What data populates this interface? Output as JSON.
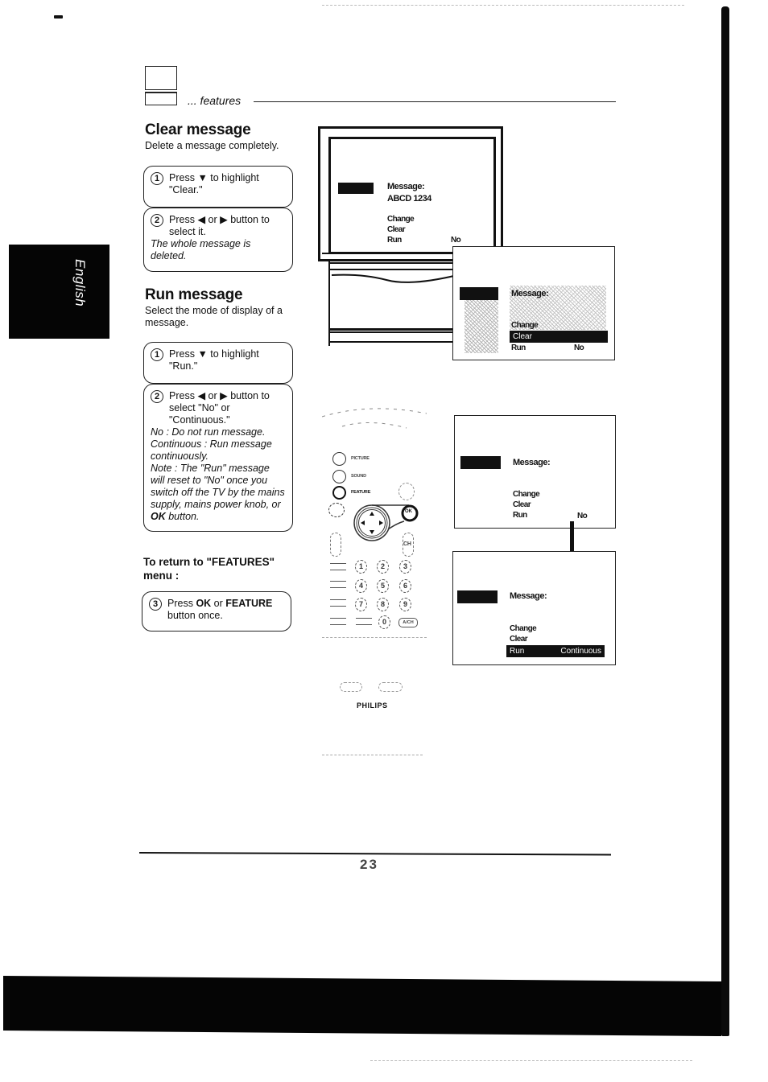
{
  "header": {
    "section_label": "... features",
    "icon": "tv-set-icon"
  },
  "side_tab": {
    "language": "English"
  },
  "clear_message": {
    "title": "Clear message",
    "description": "Delete a message completely.",
    "steps": [
      {
        "number": "1",
        "text_before": "Press ",
        "glyph": "▼",
        "text_after": " to highlight \"Clear.\""
      },
      {
        "number": "2",
        "text_before": "Press ",
        "glyph_left": "◀",
        "mid": " or ",
        "glyph_right": "▶",
        "text_after": " button to select it.",
        "note": "The whole message is deleted."
      }
    ]
  },
  "run_message": {
    "title": "Run message",
    "description": "Select the mode of display of a message.",
    "steps": [
      {
        "number": "1",
        "text_before": "Press ",
        "glyph": "▼",
        "text_after": " to highlight \"Run.\""
      },
      {
        "number": "2",
        "text_before": "Press ",
        "glyph_left": "◀",
        "mid": " or ",
        "glyph_right": "▶",
        "text_after": " button to select \"No\" or \"Continuous.\"",
        "notes": [
          "No : Do not run message.",
          "Continuous : Run message continuously.",
          "Note : The \"Run\" message will reset to \"No\" once you switch off the TV by the mains supply, mains power knob, or ",
          "OK",
          " button."
        ]
      }
    ]
  },
  "return": {
    "heading": "To return to \"FEATURES\" menu :",
    "step": {
      "number": "3",
      "pre": "Press ",
      "key1": "OK",
      "mid": " or ",
      "key2": "FEATURE",
      "post": " button once."
    }
  },
  "tv_screen": {
    "message_label": "Message:",
    "message_value": "ABCD 1234",
    "items": [
      "Change",
      "Clear",
      "Run"
    ],
    "run_value": "No"
  },
  "panel_clear": {
    "message_label": "Message:",
    "items": [
      "Change",
      "Clear",
      "Run"
    ],
    "highlighted": "Clear",
    "run_value": "No"
  },
  "panel_run_before": {
    "message_label": "Message:",
    "items": [
      "Change",
      "Clear",
      "Run"
    ],
    "run_value": "No"
  },
  "panel_run_after": {
    "message_label": "Message:",
    "items": [
      "Change",
      "Clear"
    ],
    "highlighted_label": "Run",
    "highlighted_value": "Continuous"
  },
  "remote": {
    "buttons": [
      "PICTURE",
      "SOUND",
      "FEATURE"
    ],
    "ok_label": "OK",
    "ch_label": "CH",
    "numbers": [
      "1",
      "2",
      "3",
      "4",
      "5",
      "6",
      "7",
      "8",
      "9",
      "0"
    ],
    "av_label": "A/CH",
    "brand": "PHILIPS"
  },
  "footer": {
    "page_number": "23"
  }
}
